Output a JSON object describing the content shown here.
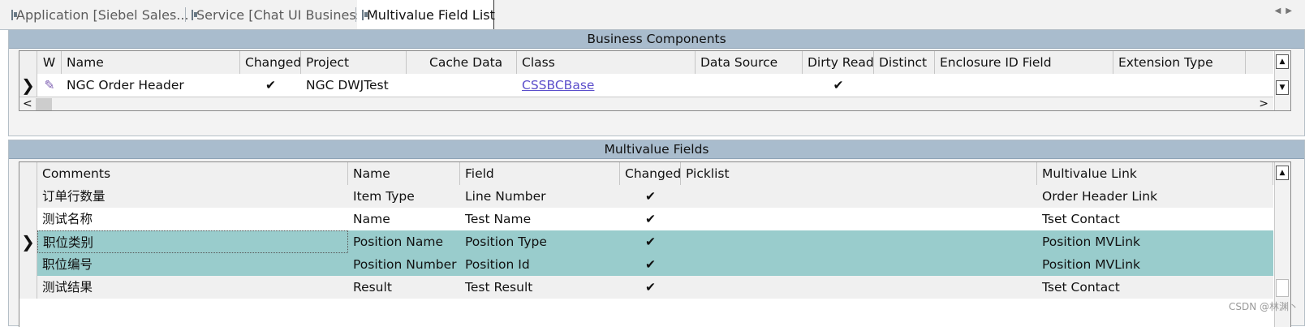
{
  "tabs": [
    {
      "label": "Application [Siebel Sales..."
    },
    {
      "label": "Service [Chat UI Business..."
    },
    {
      "label": "Multivalue Field List"
    }
  ],
  "bc_panel": {
    "title": "Business Components",
    "columns": [
      "W",
      "Name",
      "Changed",
      "Project",
      "Cache Data",
      "Class",
      "Data Source",
      "Dirty Read",
      "Distinct",
      "Enclosure ID Field",
      "Extension Type"
    ],
    "row": {
      "selector": "❯",
      "w": "✎",
      "name": "NGC Order Header",
      "changed": "✔",
      "project": "NGC DWJTest",
      "cache_data": "",
      "class": "CSSBCBase",
      "data_source": "",
      "dirty_read": "✔",
      "distinct": "",
      "enclosure_id_field": "",
      "extension_type": ""
    },
    "scroll_left": "<",
    "scroll_right": ">"
  },
  "mvf_panel": {
    "title": "Multivalue Fields",
    "columns": [
      "Comments",
      "Name",
      "Field",
      "Changed",
      "Picklist",
      "Multivalue Link"
    ],
    "rows": [
      {
        "selector": "",
        "comments": "订单行数量",
        "name": "Item Type",
        "field": "Line Number",
        "changed": "✔",
        "picklist": "",
        "mvlink": "Order Header Link"
      },
      {
        "selector": "",
        "comments": "测试名称",
        "name": "Name",
        "field": "Test Name",
        "changed": "✔",
        "picklist": "",
        "mvlink": "Tset Contact"
      },
      {
        "selector": "❯",
        "comments": "职位类别",
        "name": "Position Name",
        "field": "Position Type",
        "changed": "✔",
        "picklist": "",
        "mvlink": "Position MVLink"
      },
      {
        "selector": "",
        "comments": "职位编号",
        "name": "Position Number",
        "field": "Position Id",
        "changed": "✔",
        "picklist": "",
        "mvlink": "Position MVLink"
      },
      {
        "selector": "",
        "comments": "测试结果",
        "name": "Result",
        "field": "Test Result",
        "changed": "✔",
        "picklist": "",
        "mvlink": "Tset Contact"
      }
    ]
  },
  "scroll_up": "▲",
  "scroll_down": "▼",
  "watermark": "CSDN @林渊丶",
  "colors": {
    "panel_title_bg": "#a9bccd",
    "selected_row_bg": "#99cccc",
    "header_bg": "#f0f0f0",
    "link": "#5b4ecb"
  }
}
